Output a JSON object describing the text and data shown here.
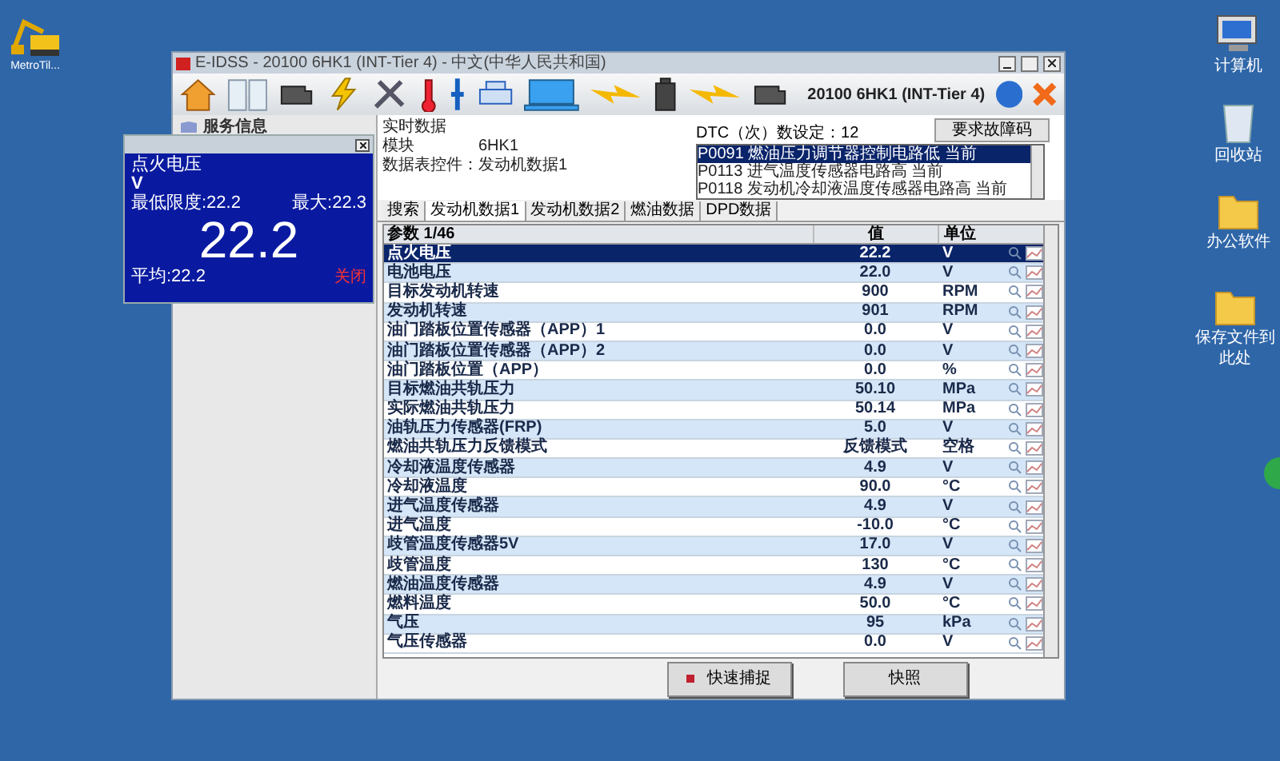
{
  "desktop_icons": [
    {
      "label": "MetroTil...",
      "kind": "excavator"
    },
    {
      "label": "计算机",
      "kind": "computer"
    },
    {
      "label": "回收站",
      "kind": "bin"
    },
    {
      "label": "办公软件",
      "kind": "folder"
    },
    {
      "label": "保存文件到此处",
      "kind": "folder"
    }
  ],
  "window": {
    "title": "E-IDSS - 20100 6HK1 (INT-Tier 4) - 中文(中华人民共和国)",
    "vehicle": "20100 6HK1 (INT-Tier 4)"
  },
  "sidebar": {
    "header": "服务信息"
  },
  "gauge_popup": {
    "name": "点火电压",
    "unit": "V",
    "min": "最低限度:22.2",
    "max": "最大:22.3",
    "value": "22.2",
    "average": "平均:22.2",
    "close": "关闭"
  },
  "info": {
    "title": "实时数据",
    "module_label": "模块",
    "module_value": "6HK1",
    "table_label": "数据表控件：",
    "table_value": "发动机数据1",
    "dtc_count": "DTC（次）数设定：12",
    "dtc_button": "要求故障码",
    "dtc_list": [
      {
        "text": "P0091 燃油压力调节器控制电路低 当前",
        "selected": true
      },
      {
        "text": "P0113 进气温度传感器电路高 当前",
        "selected": false
      },
      {
        "text": "P0118 发动机冷却液温度传感器电路高 当前",
        "selected": false
      }
    ]
  },
  "tabs": [
    {
      "label": "搜索",
      "selected": false
    },
    {
      "label": "发动机数据1",
      "selected": true
    },
    {
      "label": "发动机数据2",
      "selected": false
    },
    {
      "label": "燃油数据",
      "selected": false
    },
    {
      "label": "DPD数据",
      "selected": false
    }
  ],
  "table": {
    "columns": [
      "参数 1/46",
      "值",
      "单位"
    ],
    "rows": [
      {
        "param": "点火电压",
        "value": "22.2",
        "unit": "V",
        "selected": true
      },
      {
        "param": "电池电压",
        "value": "22.0",
        "unit": "V",
        "selected": false
      },
      {
        "param": "目标发动机转速",
        "value": "900",
        "unit": "RPM",
        "selected": false
      },
      {
        "param": "发动机转速",
        "value": "901",
        "unit": "RPM",
        "selected": false
      },
      {
        "param": "油门踏板位置传感器（APP）1",
        "value": "0.0",
        "unit": "V",
        "selected": false
      },
      {
        "param": "油门踏板位置传感器（APP）2",
        "value": "0.0",
        "unit": "V",
        "selected": false
      },
      {
        "param": "油门踏板位置（APP）",
        "value": "0.0",
        "unit": "%",
        "selected": false
      },
      {
        "param": "目标燃油共轨压力",
        "value": "50.10",
        "unit": "MPa",
        "selected": false
      },
      {
        "param": "实际燃油共轨压力",
        "value": "50.14",
        "unit": "MPa",
        "selected": false
      },
      {
        "param": "油轨压力传感器(FRP)",
        "value": "5.0",
        "unit": "V",
        "selected": false
      },
      {
        "param": "燃油共轨压力反馈模式",
        "value": "反馈模式",
        "unit": "空格",
        "selected": false
      },
      {
        "param": "冷却液温度传感器",
        "value": "4.9",
        "unit": "V",
        "selected": false
      },
      {
        "param": "冷却液温度",
        "value": "90.0",
        "unit": "°C",
        "selected": false
      },
      {
        "param": "进气温度传感器",
        "value": "4.9",
        "unit": "V",
        "selected": false
      },
      {
        "param": "进气温度",
        "value": "-10.0",
        "unit": "°C",
        "selected": false
      },
      {
        "param": "歧管温度传感器5V",
        "value": "17.0",
        "unit": "V",
        "selected": false
      },
      {
        "param": "歧管温度",
        "value": "130",
        "unit": "°C",
        "selected": false
      },
      {
        "param": "燃油温度传感器",
        "value": "4.9",
        "unit": "V",
        "selected": false
      },
      {
        "param": "燃料温度",
        "value": "50.0",
        "unit": "°C",
        "selected": false
      },
      {
        "param": "气压",
        "value": "95",
        "unit": "kPa",
        "selected": false
      },
      {
        "param": "气压传感器",
        "value": "0.0",
        "unit": "V",
        "selected": false
      }
    ]
  },
  "buttons": [
    {
      "label": "快速捕捉",
      "kind": "record"
    },
    {
      "label": "快照",
      "kind": "plain"
    }
  ]
}
